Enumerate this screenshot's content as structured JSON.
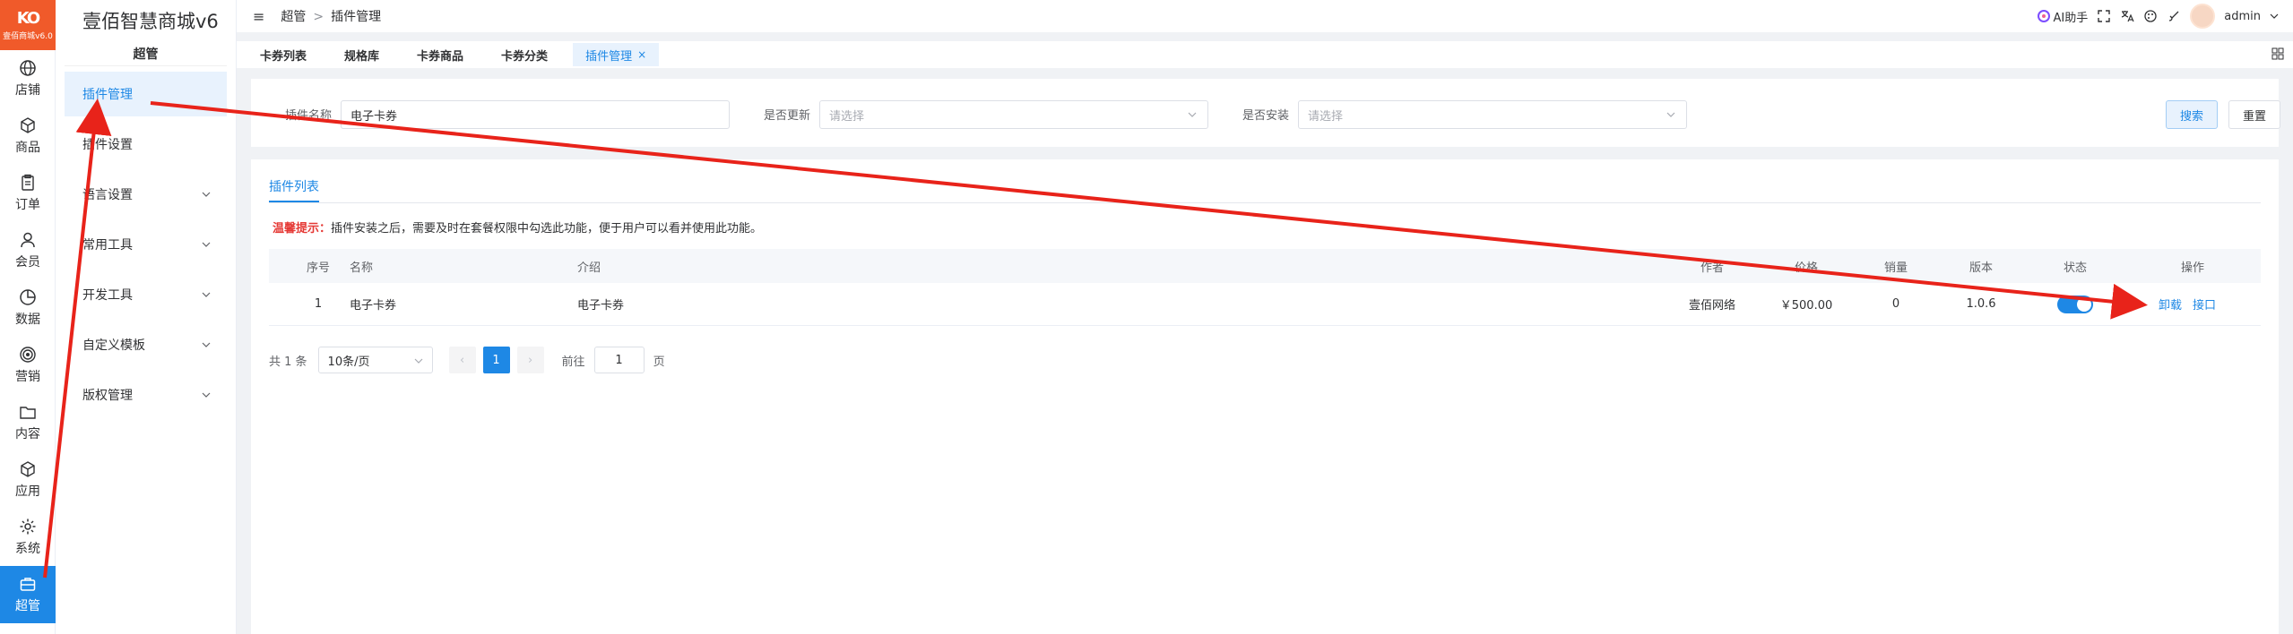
{
  "brand": {
    "logo_text": "KO",
    "logo_sub": "壹佰商城v6.0",
    "title": "壹佰智慧商城v6",
    "accent": "#1e88e5",
    "logo_bg": "#f05a2a"
  },
  "rail": [
    {
      "label": "店铺",
      "icon": "globe-icon"
    },
    {
      "label": "商品",
      "icon": "box-icon"
    },
    {
      "label": "订单",
      "icon": "clipboard-icon"
    },
    {
      "label": "会员",
      "icon": "user-icon"
    },
    {
      "label": "数据",
      "icon": "pie-chart-icon"
    },
    {
      "label": "营销",
      "icon": "target-icon"
    },
    {
      "label": "内容",
      "icon": "folder-icon"
    },
    {
      "label": "应用",
      "icon": "cube-icon"
    },
    {
      "label": "系统",
      "icon": "gear-icon"
    },
    {
      "label": "超管",
      "icon": "briefcase-icon",
      "active": true
    }
  ],
  "sidebar": {
    "group": "超管",
    "items": [
      {
        "label": "插件管理",
        "active": true,
        "chevron": false
      },
      {
        "label": "插件设置",
        "chevron": false
      },
      {
        "label": "语言设置",
        "chevron": true
      },
      {
        "label": "常用工具",
        "chevron": true
      },
      {
        "label": "开发工具",
        "chevron": true
      },
      {
        "label": "自定义模板",
        "chevron": true
      },
      {
        "label": "版权管理",
        "chevron": true
      }
    ]
  },
  "header": {
    "breadcrumb": [
      "超管",
      "插件管理"
    ],
    "separator": ">",
    "ai_label": "AI助手",
    "user": "admin"
  },
  "tabs": [
    {
      "label": "卡券列表"
    },
    {
      "label": "规格库"
    },
    {
      "label": "卡券商品"
    },
    {
      "label": "卡券分类"
    },
    {
      "label": "插件管理",
      "active": true,
      "close": "×"
    }
  ],
  "filters": {
    "name_label": "插件名称",
    "name_value": "电子卡券",
    "update_label": "是否更新",
    "update_placeholder": "请选择",
    "install_label": "是否安装",
    "install_placeholder": "请选择",
    "search_button": "搜索",
    "reset_button": "重置"
  },
  "list": {
    "tab_label": "插件列表",
    "tip_prefix": "温馨提示：",
    "tip_text": "插件安装之后，需要及时在套餐权限中勾选此功能，便于用户可以看并使用此功能。",
    "columns": [
      "序号",
      "名称",
      "介绍",
      "作者",
      "价格",
      "销量",
      "版本",
      "状态",
      "操作"
    ],
    "rows": [
      {
        "index": "1",
        "name": "电子卡券",
        "intro": "电子卡券",
        "author": "壹佰网络",
        "price": "￥500.00",
        "sales": "0",
        "version": "1.0.6",
        "enabled": true,
        "actions": [
          "卸载",
          "接口"
        ]
      }
    ]
  },
  "pagination": {
    "total": "共 1 条",
    "page_size": "10条/页",
    "prev": "‹",
    "current": "1",
    "next": "›",
    "goto_label": "前往",
    "goto_value": "1",
    "page_suffix": "页"
  }
}
